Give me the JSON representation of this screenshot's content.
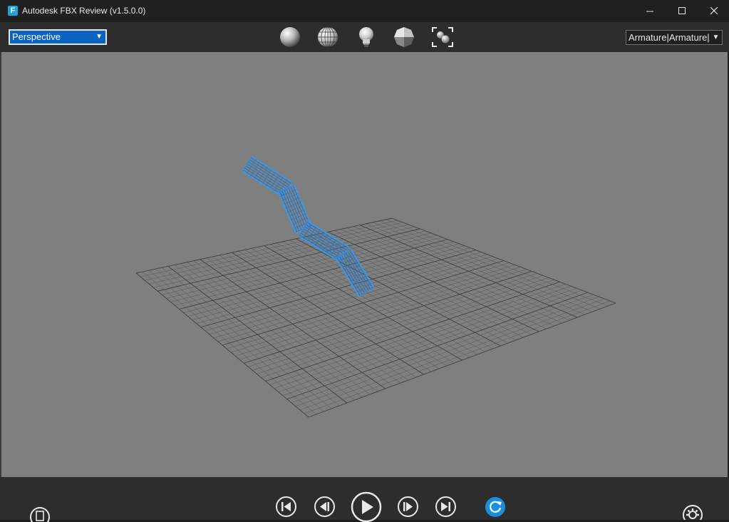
{
  "window": {
    "title": "Autodesk FBX Review (v1.5.0.0)",
    "app_icon_letter": "F",
    "minimize_glyph": "—",
    "maximize_glyph": "☐",
    "close_glyph": "✕"
  },
  "toolbar": {
    "view_mode": "Perspective",
    "take": "Armature|Armature|Action",
    "icons": [
      "shaded-sphere-icon",
      "wireframe-sphere-icon",
      "light-bulb-icon",
      "flat-shaded-sphere-icon",
      "frame-selection-icon"
    ]
  },
  "viewport": {
    "background": "#7f7f7f",
    "grid_color": "#3a3a3a",
    "mesh_color": "#3f97e0"
  },
  "playback": {
    "controls": [
      "skip-to-start-icon",
      "step-back-icon",
      "play-icon",
      "step-forward-icon",
      "skip-to-end-icon",
      "loop-icon",
      "settings-icon"
    ],
    "accent": "#1a8ee0"
  }
}
